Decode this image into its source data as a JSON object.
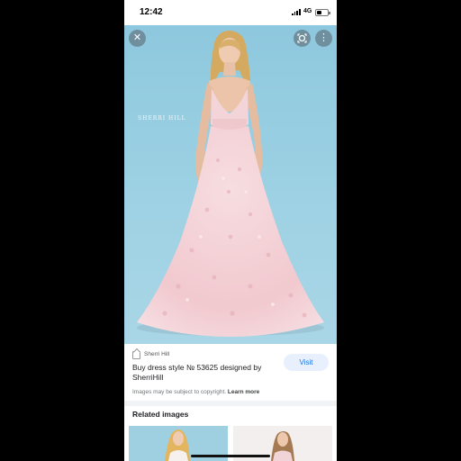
{
  "status_bar": {
    "time": "12:42",
    "network": "4G"
  },
  "image_viewer": {
    "watermark": "SHERRI HILL",
    "close_icon": "close-icon",
    "lens_icon": "lens-icon",
    "more_icon": "more-vert-icon"
  },
  "result": {
    "source_name": "Sherri Hill",
    "title": "Buy dress style № 53625 designed by SherriHill",
    "visit_label": "Visit",
    "copyright_text": "Images may be subject to copyright.",
    "learn_more": "Learn more"
  },
  "related": {
    "heading": "Related images"
  },
  "colors": {
    "accent": "#1a73e8",
    "visit_bg": "#e8f0fe",
    "backdrop": "#9fd2e4",
    "dress": "#f2cfd3"
  }
}
